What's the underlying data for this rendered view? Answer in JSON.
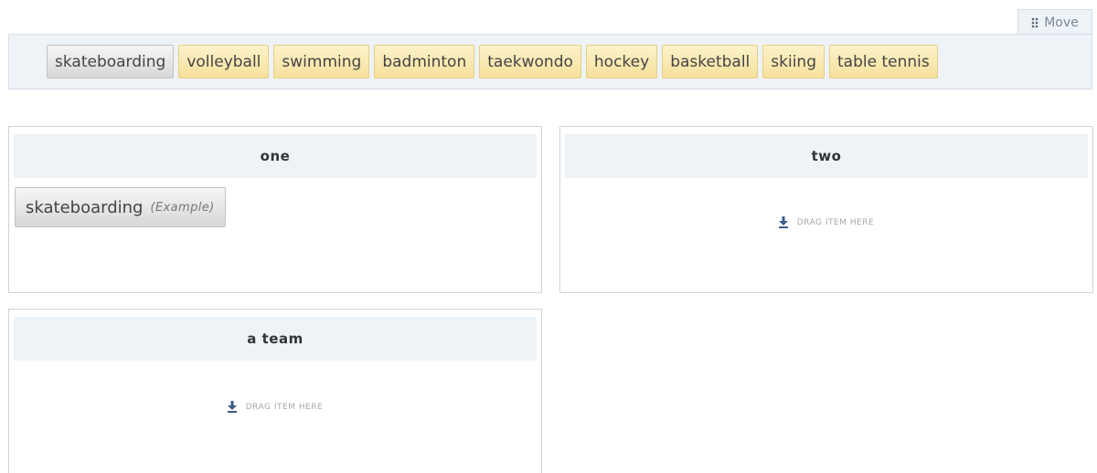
{
  "toolbar": {
    "move_label": "Move",
    "move_icon": "grip-icon"
  },
  "pool": {
    "items": [
      {
        "label": "skateboarding",
        "state": "selected"
      },
      {
        "label": "volleyball",
        "state": "available"
      },
      {
        "label": "swimming",
        "state": "available"
      },
      {
        "label": "badminton",
        "state": "available"
      },
      {
        "label": "taekwondo",
        "state": "available"
      },
      {
        "label": "hockey",
        "state": "available"
      },
      {
        "label": "basketball",
        "state": "available"
      },
      {
        "label": "skiing",
        "state": "available"
      },
      {
        "label": "table tennis",
        "state": "available"
      }
    ]
  },
  "boxes": {
    "one": {
      "title": "one",
      "item_label": "skateboarding",
      "item_note": "(Example)"
    },
    "two": {
      "title": "two",
      "drop_hint": "DRAG ITEM HERE",
      "drop_icon": "down-arrow-icon"
    },
    "team": {
      "title": "a team",
      "drop_hint": "DRAG ITEM HERE",
      "drop_icon": "down-arrow-icon"
    }
  },
  "colors": {
    "chip_yellow": "#f6e09b",
    "chip_grey": "#d7d7d7",
    "panel_bg": "#eef3f8",
    "drop_arrow": "#3d5a8a"
  }
}
